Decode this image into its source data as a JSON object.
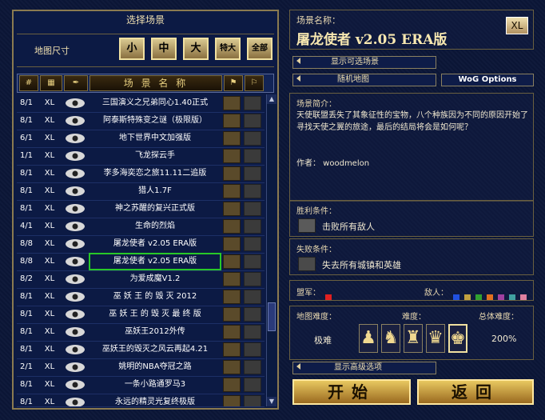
{
  "left": {
    "title": "选择场景",
    "size_label": "地图尺寸",
    "size_buttons": [
      "小",
      "中",
      "大",
      "特大",
      "全部"
    ],
    "headers": {
      "players": "#",
      "size": "",
      "name": "场 景 名 称"
    },
    "rows": [
      {
        "players": "8/1",
        "size": "XL",
        "name": "三国演义之兄弟同心1.40正式"
      },
      {
        "players": "8/1",
        "size": "XL",
        "name": "阿泰斯特殊变之谜（极限版）"
      },
      {
        "players": "6/1",
        "size": "XL",
        "name": "地下世界中文加强版"
      },
      {
        "players": "1/1",
        "size": "XL",
        "name": "飞龙探云手"
      },
      {
        "players": "8/1",
        "size": "XL",
        "name": "李多海奕恋之旅11.11二追版"
      },
      {
        "players": "8/1",
        "size": "XL",
        "name": "猎人1.7F"
      },
      {
        "players": "8/1",
        "size": "XL",
        "name": "神之苏醒的复兴正式版"
      },
      {
        "players": "4/1",
        "size": "XL",
        "name": "生命的烈焰"
      },
      {
        "players": "8/8",
        "size": "XL",
        "name": "屠龙使者 v2.05 ERA版"
      },
      {
        "players": "8/8",
        "size": "XL",
        "name": "屠龙使者 v2.05 ERA版"
      },
      {
        "players": "8/2",
        "size": "XL",
        "name": "为爱成魔V1.2"
      },
      {
        "players": "8/1",
        "size": "XL",
        "name": "巫 妖 王 的 毁 灭 2012"
      },
      {
        "players": "8/1",
        "size": "XL",
        "name": "巫 妖 王 的 毁 灭 最 终 版"
      },
      {
        "players": "8/1",
        "size": "XL",
        "name": "巫妖王2012外传"
      },
      {
        "players": "8/1",
        "size": "XL",
        "name": "巫妖王的毁灭之风云再起4.21"
      },
      {
        "players": "2/1",
        "size": "XL",
        "name": "姚明的NBA夺冠之路"
      },
      {
        "players": "8/1",
        "size": "XL",
        "name": "一条小路通罗马3"
      },
      {
        "players": "8/1",
        "size": "XL",
        "name": "永远的精灵光复终极版"
      }
    ]
  },
  "right": {
    "scenario_name_label": "场景名称：",
    "scenario_name": "屠龙使者 v2.05 ERA版",
    "size_badge": "XL",
    "show_scenarios": "显示可选场景",
    "random_map": "随机地图",
    "wog_options": "WoG Options",
    "desc_label": "场景简介：",
    "description": "天使联盟丢失了其象征性的宝物，八个种族因为不同的原因开始了寻找天使之翼的旅途，最后的结局将会是如何呢？",
    "author": "作者： woodmelon",
    "victory_label": "胜利条件：",
    "victory": "击败所有敌人",
    "loss_label": "失败条件：",
    "loss": "失去所有城镇和英雄",
    "allies_label": "盟军：",
    "enemies_label": "敌人：",
    "map_difficulty_label": "地图难度：",
    "difficulty_label": "难度：",
    "overall_label": "总体难度：",
    "map_difficulty": "极难",
    "overall": "200%",
    "advanced": "显示高级选项",
    "start": "开始",
    "back": "返回",
    "colors": {
      "accent": "#f0d890",
      "selection": "#28c828"
    }
  }
}
